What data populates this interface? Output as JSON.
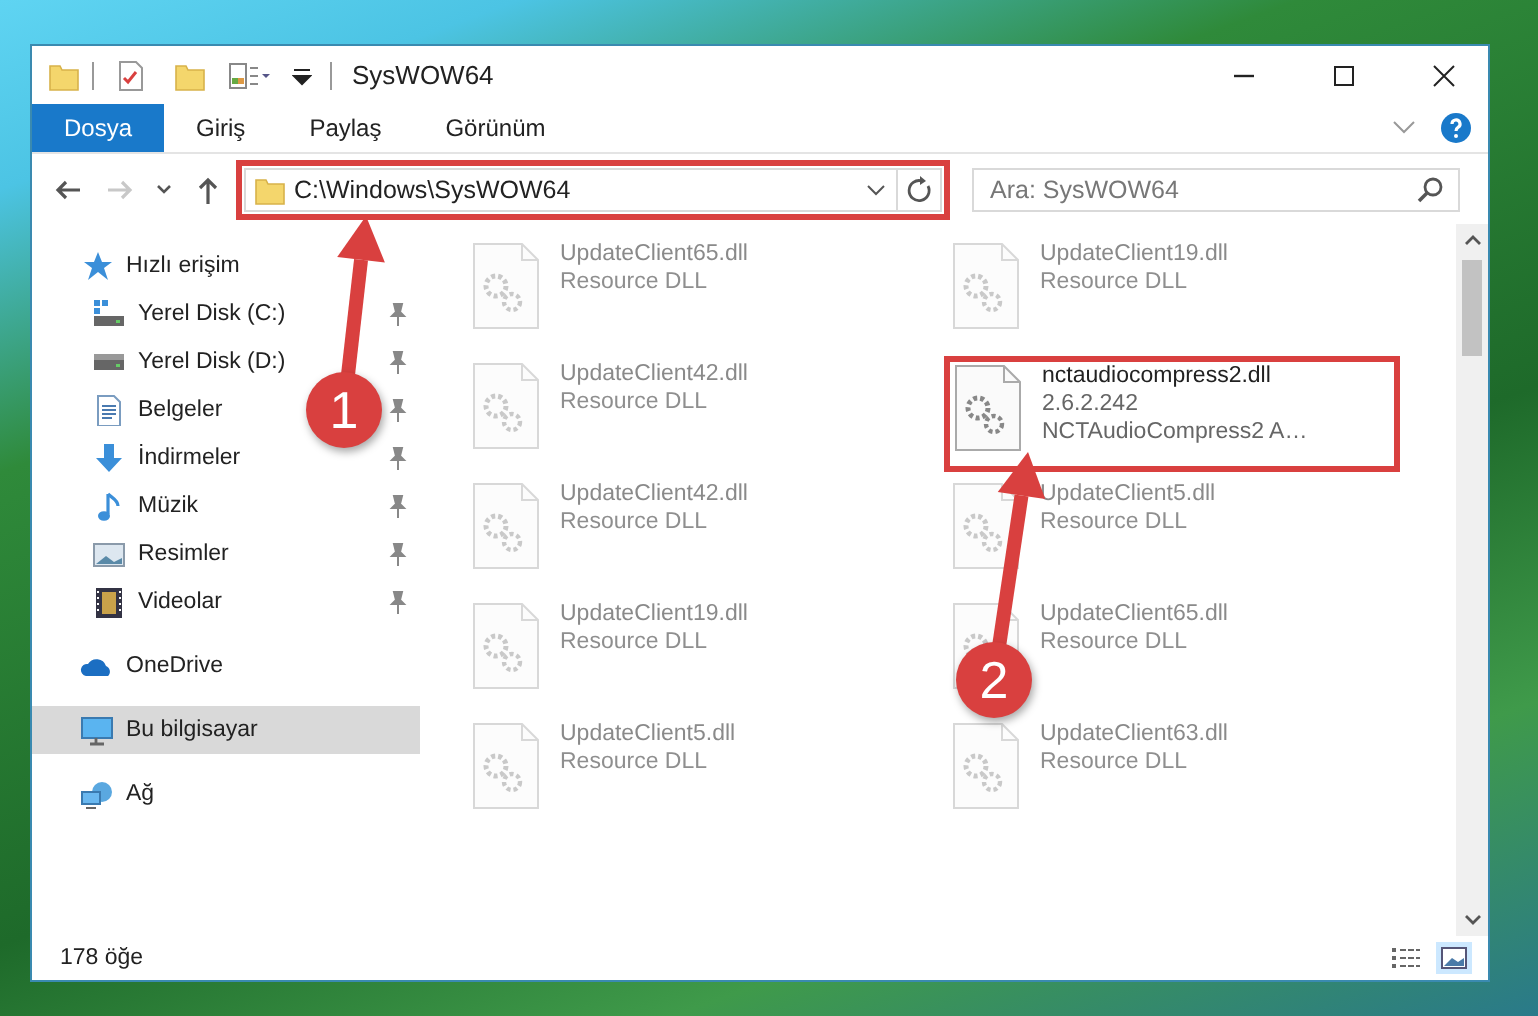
{
  "window": {
    "title": "SysWOW64"
  },
  "ribbon_tabs": [
    {
      "label": "Dosya",
      "selected": true
    },
    {
      "label": "Giriş",
      "selected": false
    },
    {
      "label": "Paylaş",
      "selected": false
    },
    {
      "label": "Görünüm",
      "selected": false
    }
  ],
  "nav_buttons": [
    {
      "kind": "back",
      "disabled": false
    },
    {
      "kind": "forward",
      "disabled": true
    },
    {
      "kind": "recent",
      "disabled": false
    },
    {
      "kind": "up",
      "disabled": false
    }
  ],
  "address_bar": {
    "path": "C:\\Windows\\SysWOW64",
    "highlighted": true
  },
  "search": {
    "placeholder": "Ara: SysWOW64"
  },
  "sidebar": {
    "items": [
      {
        "label": "Hızlı erişim",
        "kind": "star",
        "selected": false,
        "children": [
          {
            "label": "Yerel Disk (C:)",
            "kind": "drive-c",
            "pinned": true
          },
          {
            "label": "Yerel Disk (D:)",
            "kind": "drive",
            "pinned": true
          },
          {
            "label": "Belgeler",
            "kind": "document",
            "pinned": true
          },
          {
            "label": "İndirmeler",
            "kind": "download",
            "pinned": true
          },
          {
            "label": "Müzik",
            "kind": "music",
            "pinned": true
          },
          {
            "label": "Resimler",
            "kind": "pictures",
            "pinned": true
          },
          {
            "label": "Videolar",
            "kind": "video",
            "pinned": true
          }
        ]
      },
      {
        "label": "OneDrive",
        "kind": "cloud",
        "selected": false
      },
      {
        "label": "Bu bilgisayar",
        "kind": "computer",
        "selected": true
      },
      {
        "label": "Ağ",
        "kind": "network",
        "selected": false
      }
    ]
  },
  "files": [
    {
      "name": "UpdateClient65.dll",
      "details": [
        "Resource DLL"
      ],
      "blurred": true,
      "highlighted": false
    },
    {
      "name": "UpdateClient19.dll",
      "details": [
        "Resource DLL"
      ],
      "blurred": true,
      "highlighted": false
    },
    {
      "name": "UpdateClient42.dll",
      "details": [
        "Resource DLL"
      ],
      "blurred": true,
      "highlighted": false
    },
    {
      "name": "nctaudiocompress2.dll",
      "details": [
        "2.6.2.242",
        "NCTAudioCompress2 A…"
      ],
      "blurred": false,
      "highlighted": true
    },
    {
      "name": "UpdateClient42.dll",
      "details": [
        "Resource DLL"
      ],
      "blurred": true,
      "highlighted": false
    },
    {
      "name": "UpdateClient5.dll",
      "details": [
        "Resource DLL"
      ],
      "blurred": true,
      "highlighted": false
    },
    {
      "name": "UpdateClient19.dll",
      "details": [
        "Resource DLL"
      ],
      "blurred": true,
      "highlighted": false
    },
    {
      "name": "UpdateClient65.dll",
      "details": [
        "Resource DLL"
      ],
      "blurred": true,
      "highlighted": false
    },
    {
      "name": "UpdateClient5.dll",
      "details": [
        "Resource DLL"
      ],
      "blurred": true,
      "highlighted": false
    },
    {
      "name": "UpdateClient63.dll",
      "details": [
        "Resource DLL"
      ],
      "blurred": true,
      "highlighted": false
    }
  ],
  "annotations": [
    {
      "label": "1"
    },
    {
      "label": "2"
    }
  ],
  "status_bar": {
    "item_count": "178 öğe"
  }
}
